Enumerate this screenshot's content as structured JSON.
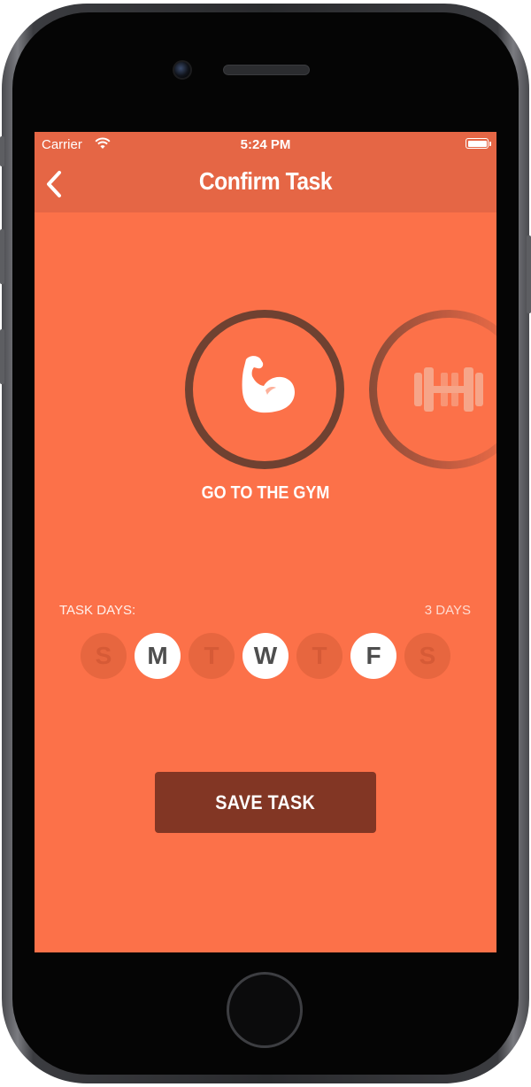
{
  "status_bar": {
    "carrier": "Carrier",
    "time": "5:24 PM",
    "icons": [
      "wifi-icon",
      "battery-icon"
    ]
  },
  "nav": {
    "title": "Confirm Task",
    "back_icon": "chevron-left-icon"
  },
  "task_carousel": {
    "selected_task": {
      "label": "GO TO THE GYM",
      "icon": "flexed-bicep-icon"
    },
    "next_task": {
      "icon": "dumbbell-icon"
    }
  },
  "schedule": {
    "label": "TASK DAYS:",
    "count_text": "3 DAYS",
    "days": [
      {
        "letter": "S",
        "selected": false
      },
      {
        "letter": "M",
        "selected": true
      },
      {
        "letter": "T",
        "selected": false
      },
      {
        "letter": "W",
        "selected": true
      },
      {
        "letter": "T",
        "selected": false
      },
      {
        "letter": "F",
        "selected": true
      },
      {
        "letter": "S",
        "selected": false
      }
    ]
  },
  "save_button": {
    "label": "SAVE TASK"
  },
  "colors": {
    "background": "#fc7149",
    "nav_bar": "#e56645",
    "save_button": "#823624",
    "selected_ring": "#6f4131",
    "day_selected": "#ffffff",
    "day_unselected": "#e7663f"
  }
}
